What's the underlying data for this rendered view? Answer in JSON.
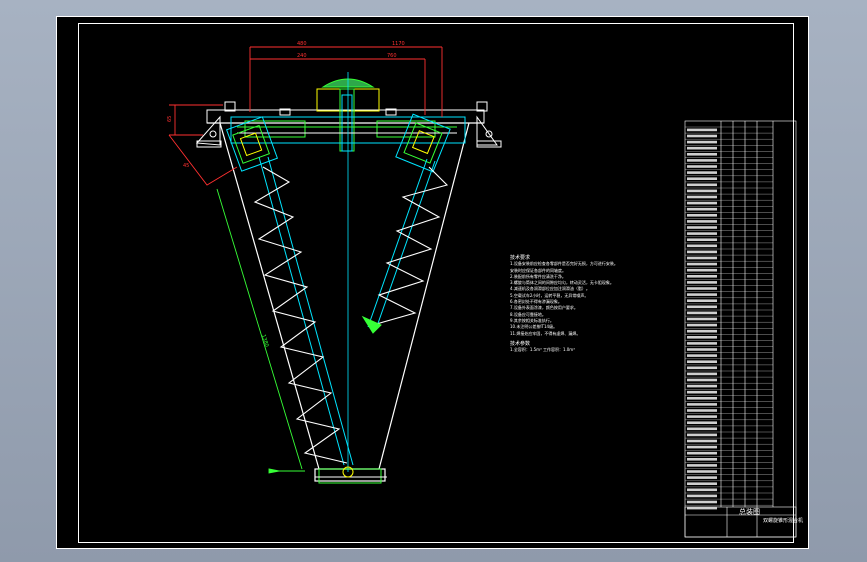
{
  "drawing": {
    "dimension_labels": {
      "top_left": "480",
      "top_inner": "240",
      "top_right": "1170",
      "top_right_inner": "760",
      "left_side": "65",
      "left_angle": "45",
      "diagonal_length": "1380"
    }
  },
  "notes": {
    "title": "技术要求",
    "lines": [
      "1.设备安装前应检查各零部件是否完好无损，方可进行安装。",
      "  安装时应保证各部件的同轴度。",
      "2.装配前所有零件应清洗干净。",
      "3.螺旋与筒体之间的间隙应均匀，转动灵活，无卡阻现象。",
      "4.减速机及各润滑部位应加注润滑油（脂）。",
      "5.空载试车2小时，运转平稳，无异常噪声。",
      "6.各密封处不得有渗漏现象。",
      "7.设备外表面涂漆，颜色按用户要求。",
      "8.设备应可靠接地。",
      "9.其余按相关标准执行。",
      "10.未注明公差按IT14级。",
      "11.焊接处应牢固，不得有虚焊、漏焊。"
    ],
    "second_title": "技术参数",
    "second_lines": [
      "1.全容积：1.5m³  工作容积：1.0m³"
    ]
  },
  "title_block": {
    "main_label": "总装图",
    "part_label": "双螺旋锥形混合机"
  },
  "colors": {
    "frame": "#ffffff",
    "centerline": "#00e5ff",
    "dimension": "#ff3030",
    "green_line": "#36ff36",
    "yellow": "#ffff00"
  }
}
